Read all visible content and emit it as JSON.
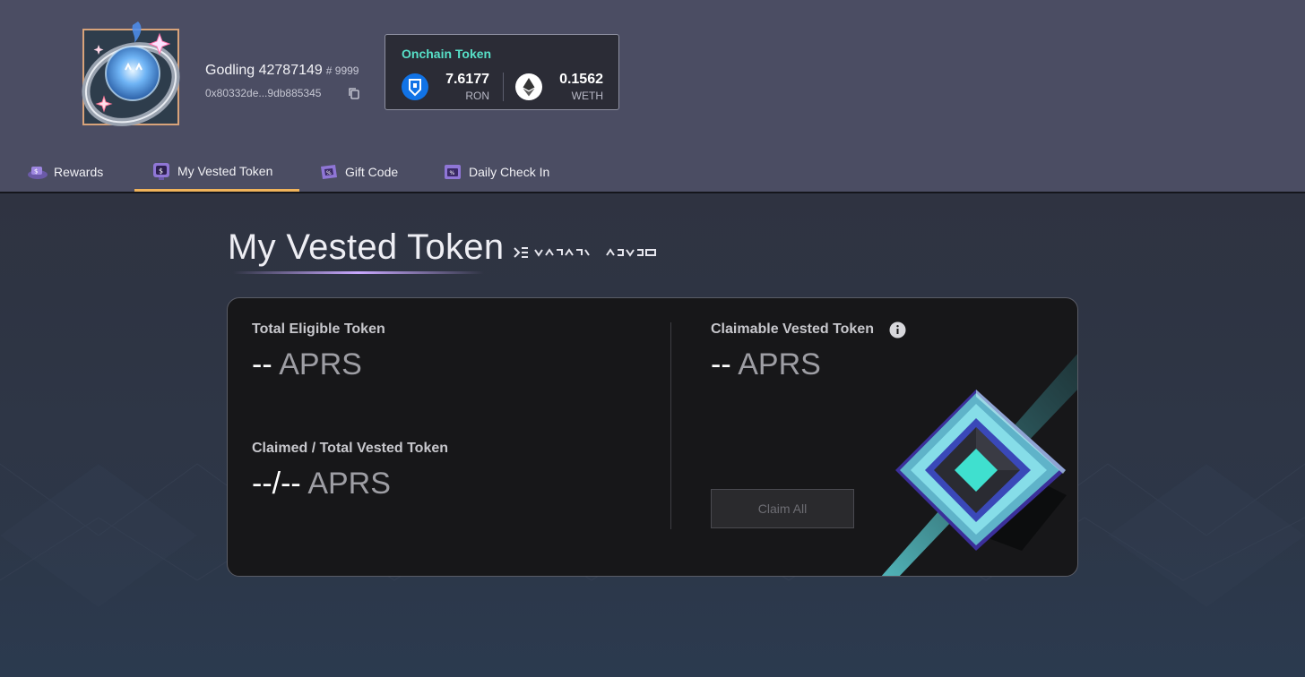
{
  "user": {
    "name": "Godling 42787149",
    "tag": "# 9999",
    "address": "0x80332de...9db885345"
  },
  "onchain": {
    "title": "Onchain Token",
    "tokens": [
      {
        "value": "7.6177",
        "unit": "RON",
        "icon": "ronin-icon"
      },
      {
        "value": "0.1562",
        "unit": "WETH",
        "icon": "ethereum-icon"
      }
    ]
  },
  "tabs": [
    {
      "label": "Rewards",
      "icon": "rewards-icon",
      "active": false
    },
    {
      "label": "My Vested Token",
      "icon": "vested-token-icon",
      "active": true
    },
    {
      "label": "Gift Code",
      "icon": "gift-code-icon",
      "active": false
    },
    {
      "label": "Daily Check In",
      "icon": "daily-check-in-icon",
      "active": false
    }
  ],
  "page": {
    "title": "My Vested Token"
  },
  "card": {
    "total_eligible": {
      "label": "Total Eligible Token",
      "value": "--",
      "unit": "APRS"
    },
    "claimed_total": {
      "label": "Claimed / Total Vested Token",
      "value": "--/--",
      "unit": "APRS"
    },
    "claimable": {
      "label": "Claimable Vested Token",
      "value": "--",
      "unit": "APRS"
    },
    "claim_button": "Claim All"
  },
  "colors": {
    "accent_teal": "#57e0c8",
    "tab_active_underline": "#f0b35a",
    "header_bg": "#4b4d63",
    "card_bg": "#171719"
  }
}
